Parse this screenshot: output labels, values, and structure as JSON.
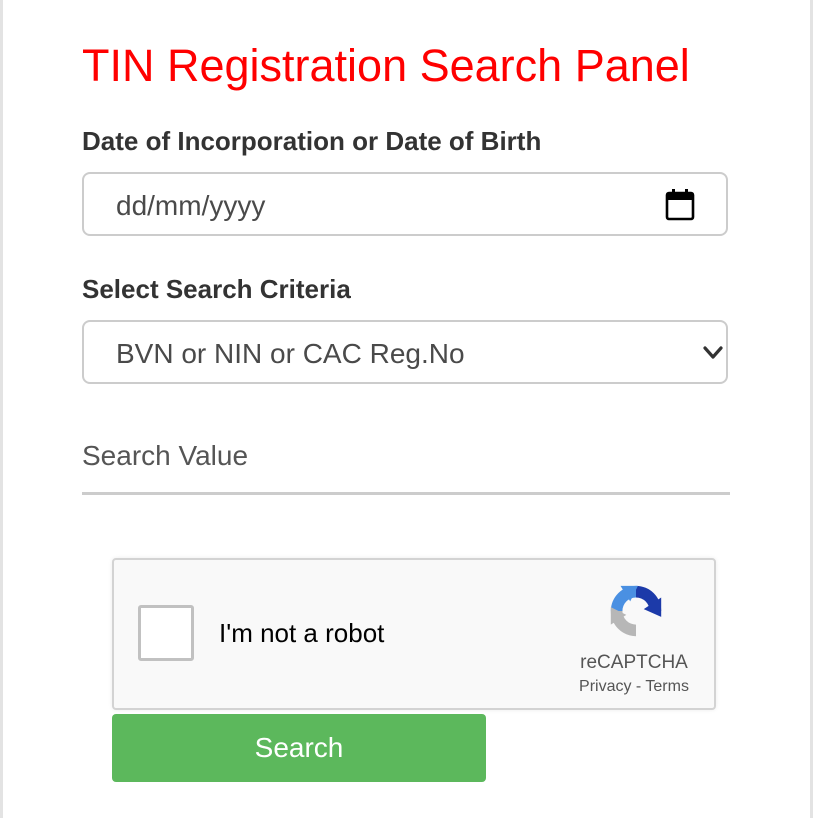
{
  "page": {
    "title": "TIN Registration Search Panel"
  },
  "form": {
    "dob_label": "Date of Incorporation or Date of Birth",
    "dob_placeholder": "dd/mm/yyyy",
    "criteria_label": "Select Search Criteria",
    "criteria_selected": "BVN or NIN or CAC Reg.No",
    "search_value_placeholder": "Search Value",
    "submit_label": "Search"
  },
  "captcha": {
    "label": "I'm not a robot",
    "brand": "reCAPTCHA",
    "privacy": "Privacy",
    "separator": "-",
    "terms": "Terms"
  },
  "colors": {
    "title": "#ff0000",
    "button": "#5cb85c",
    "recaptcha_blue": "#1c3aa9",
    "recaptcha_light_blue": "#4a90e2",
    "recaptcha_gray": "#b7b7b7"
  },
  "icons": {
    "date": "calendar-icon",
    "select": "chevron-down-icon",
    "captcha": "recaptcha-logo-icon"
  }
}
